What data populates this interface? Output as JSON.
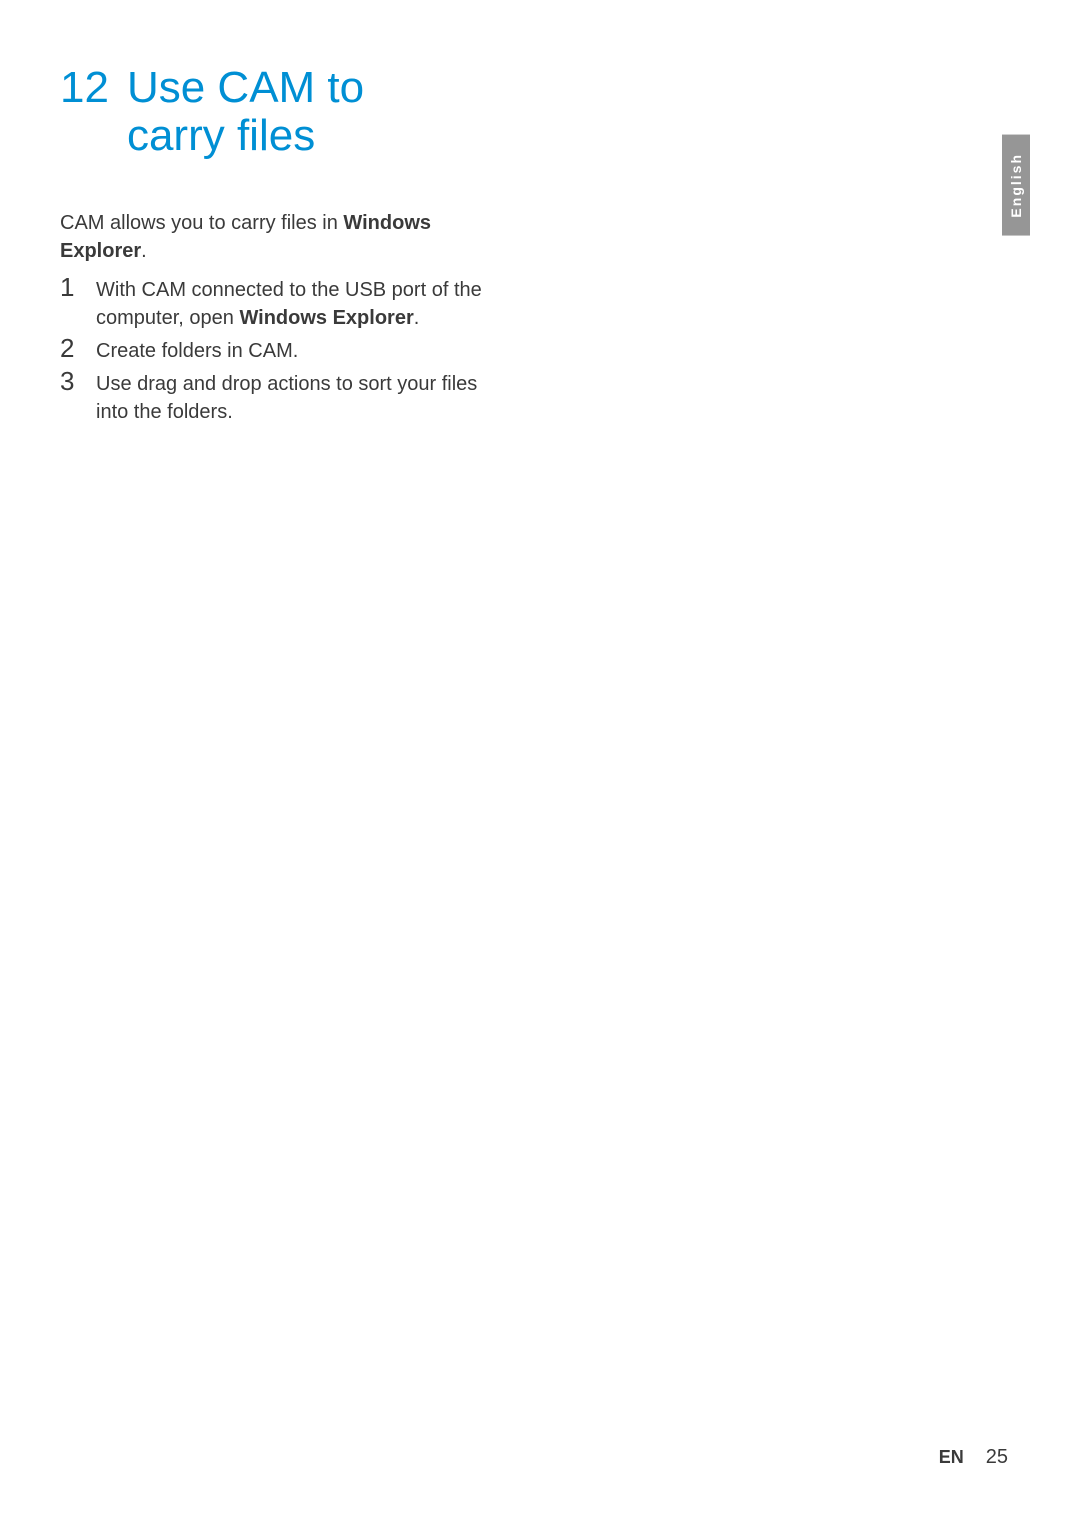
{
  "sidebar": {
    "language": "English"
  },
  "chapter": {
    "number": "12",
    "title_line1": "Use CAM to",
    "title_line2": "carry files"
  },
  "intro": {
    "before": "CAM allows you to carry files in ",
    "bold1": "Windows",
    "bold2": "Explorer",
    "after": "."
  },
  "steps": [
    {
      "num": "1",
      "before": "With CAM connected to the USB port of the computer, open ",
      "bold": "Windows Explorer",
      "after": "."
    },
    {
      "num": "2",
      "before": "Create folders in CAM.",
      "bold": "",
      "after": ""
    },
    {
      "num": "3",
      "before": "Use drag and drop actions to sort your files into the folders.",
      "bold": "",
      "after": ""
    }
  ],
  "footer": {
    "lang": "EN",
    "page": "25"
  }
}
